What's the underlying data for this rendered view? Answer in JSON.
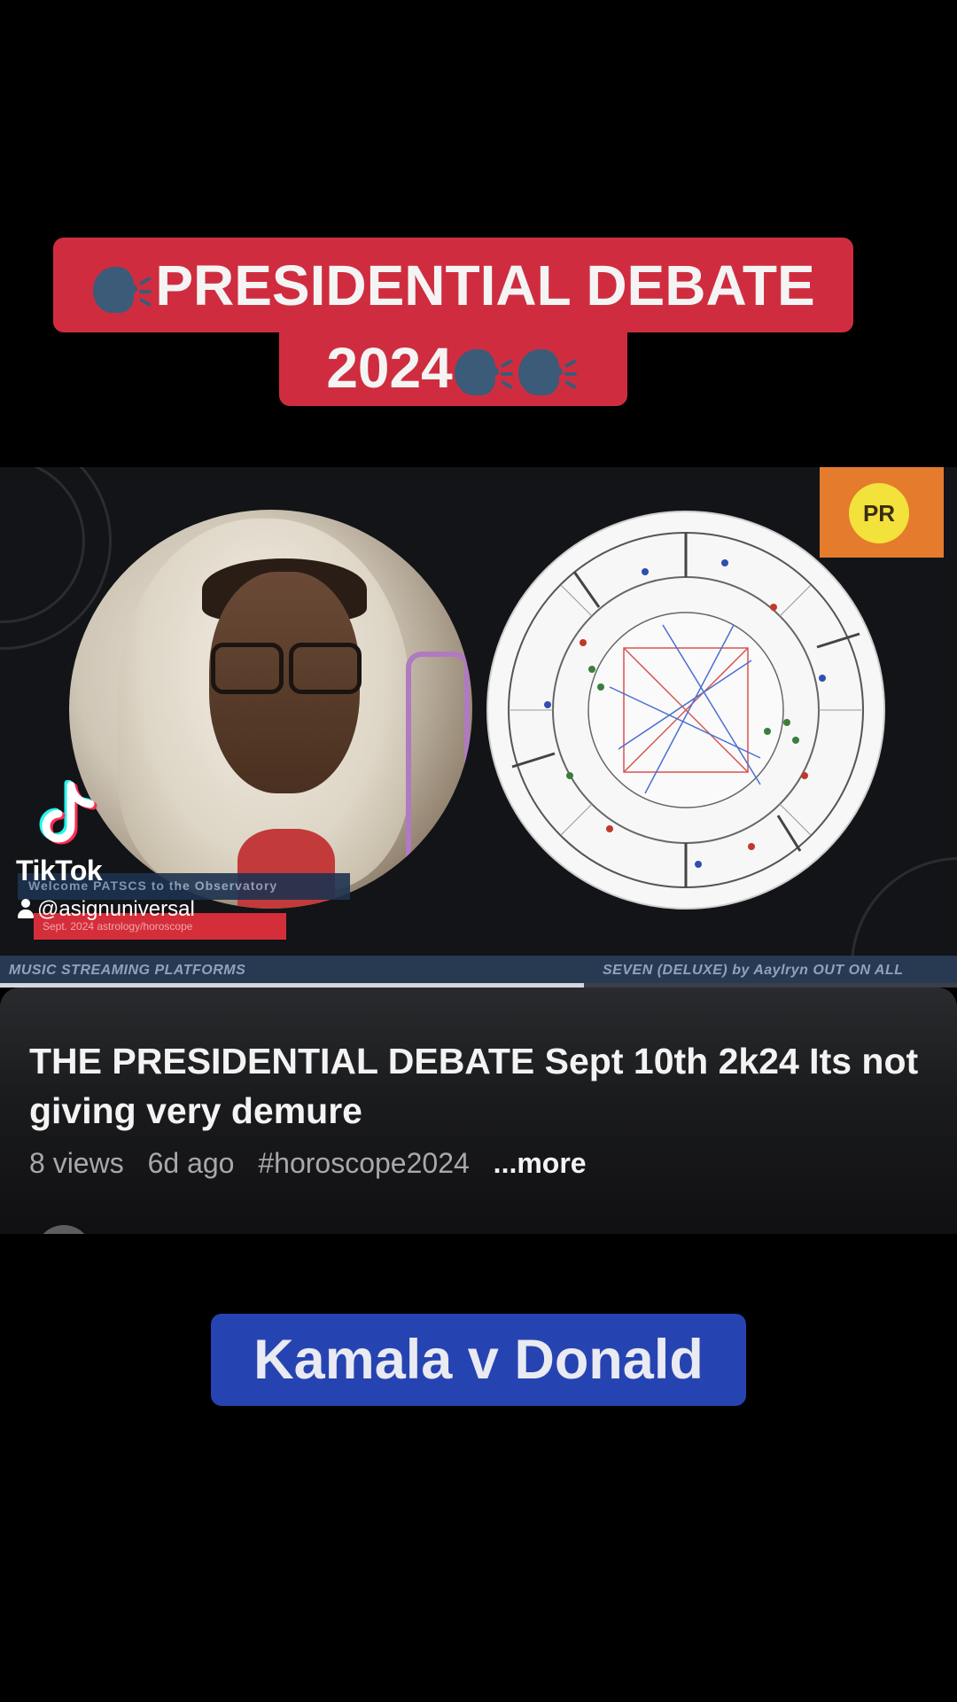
{
  "caption_top": {
    "line1": "PRESIDENTIAL DEBATE",
    "line2": "2024",
    "emoji_icon": "speaking-head-icon",
    "bg_color": "#cf2d3f"
  },
  "video": {
    "badge_text": "PR",
    "lower_third_1": "Welcome PATSCS to the Observatory",
    "lower_third_2": "Sept. 2024 astrology/horoscope",
    "ticker_left": "MUSIC STREAMING PLATFORMS",
    "ticker_right": "SEVEN (DELUXE) by Aaylryn   OUT ON ALL",
    "progress": 0.61
  },
  "watermark": {
    "brand": "TikTok",
    "handle": "@asignuniversal",
    "logo_icon": "tiktok-logo-icon",
    "user_icon": "user-icon"
  },
  "info": {
    "title": "THE PRESIDENTIAL DEBATE Sept 10th 2k24 Its not giving very demure",
    "views": "8 views",
    "age": "6d ago",
    "hashtag": "#horoscope2024",
    "more": "...more"
  },
  "caption_bottom": {
    "text": "Kamala v Donald",
    "bg_color": "#2644b1"
  }
}
